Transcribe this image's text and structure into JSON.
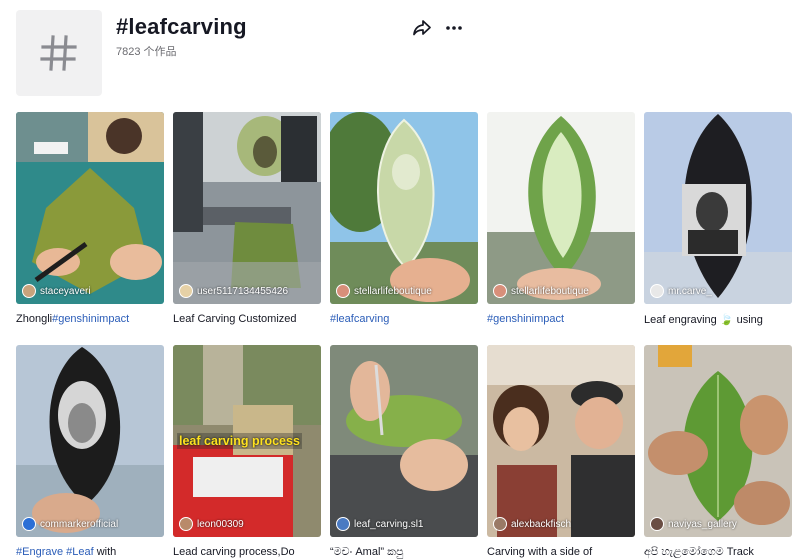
{
  "header": {
    "title": "#leafcarving",
    "count": "7823 个作品"
  },
  "videos": [
    {
      "user": "staceyaveri",
      "caption_plain": "Zhongli",
      "caption_tag": "#genshinimpact"
    },
    {
      "user": "user5117134455426",
      "caption_plain": "Leaf Carving Customized",
      "caption_tag": ""
    },
    {
      "user": "stellarlifeboutique",
      "caption_plain": "",
      "caption_tag": "#leafcarving"
    },
    {
      "user": "stellarlifeboutique",
      "caption_plain": "",
      "caption_tag": "#genshinimpact"
    },
    {
      "user": "mr.carve_",
      "caption_plain": "Leaf engraving 🍃 using",
      "caption_tag": ""
    },
    {
      "user": "commarkerofficial",
      "caption_plain": " with",
      "caption_tag": "#Engrave #Leaf"
    },
    {
      "user": "leon00309",
      "caption_plain": "Lead carving process,Do",
      "caption_tag": "",
      "overlay": "leaf carving process"
    },
    {
      "user": "leaf_carving.sl1",
      "caption_plain": "“මචං Amal” කපු",
      "caption_tag": ""
    },
    {
      "user": "alexbackfisch",
      "caption_plain": "Carving with a side of",
      "caption_tag": ""
    },
    {
      "user": "naviyas_gallery",
      "caption_plain": "අපි හැළමෝගෙම Track",
      "caption_tag": ""
    }
  ],
  "colors": {
    "link": "#2b5db8",
    "text": "#161823",
    "muted": "#6b6b70"
  },
  "icons": [
    "hashtag-icon",
    "share-icon",
    "more-icon"
  ]
}
